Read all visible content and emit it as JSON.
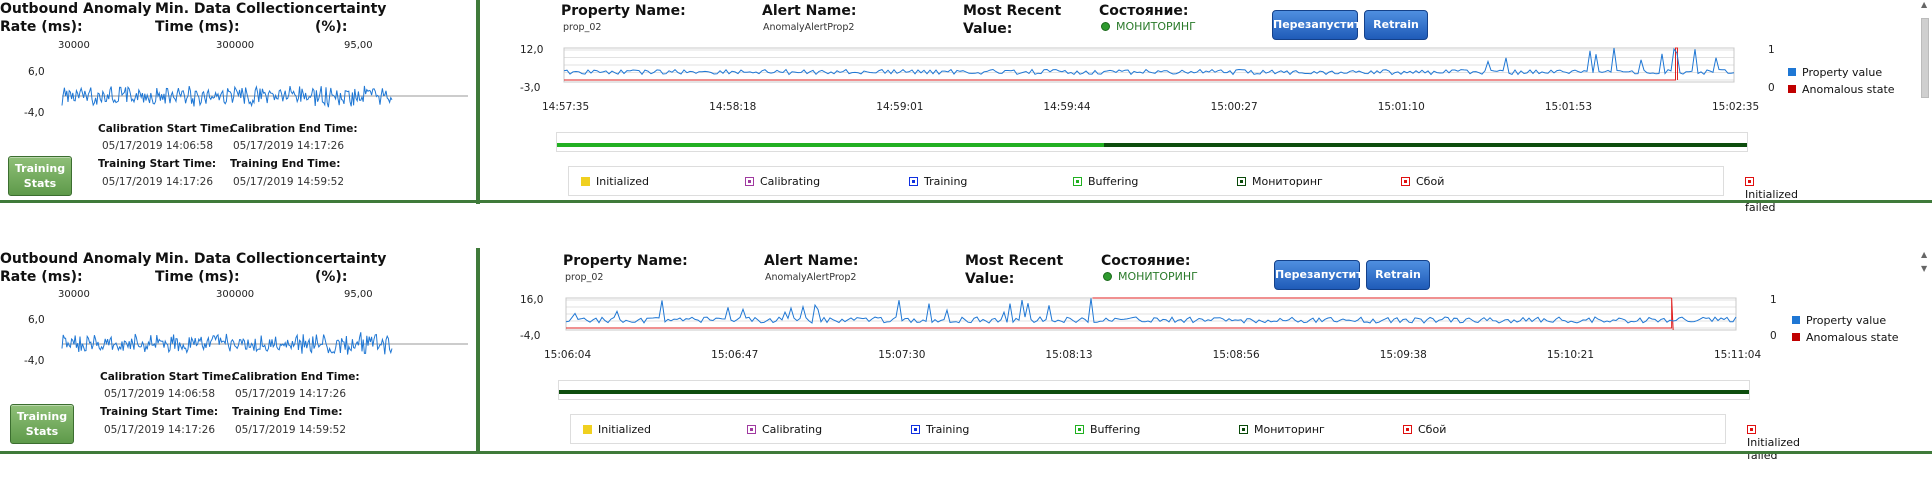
{
  "colors": {
    "series": "#1f77d4",
    "anomaly": "#e02020",
    "separator": "#3f7a3a",
    "buffering": "#22b022",
    "monitoring": "#0d4d0d"
  },
  "legend": {
    "items": [
      {
        "label": "Property value",
        "color": "#1f77d4"
      },
      {
        "label": "Anomalous state",
        "color": "#c00000"
      }
    ]
  },
  "states": [
    {
      "label": "Initialized",
      "color": "#f0d020"
    },
    {
      "label": "Calibrating",
      "color": "#a03aa0"
    },
    {
      "label": "Training",
      "color": "#1030e0"
    },
    {
      "label": "Buffering",
      "color": "#20b020"
    },
    {
      "label": "Мониторинг",
      "color": "#0a4a0a"
    },
    {
      "label": "Сбой",
      "color": "#e01010"
    },
    {
      "label": "Initialized failed",
      "color": "#e01010"
    }
  ],
  "panels": [
    {
      "outbound_label_1": "Outbound Anomaly",
      "outbound_label_2": "Rate (ms):",
      "outbound_value": "30000",
      "mincol_label_1": "Min. Data Collection",
      "mincol_label_2": "Time (ms):",
      "mincol_value": "300000",
      "certainty_label_1": "certainty",
      "certainty_label_2": "(%):",
      "certainty_value": "95,00",
      "mini_ymax": "6,0",
      "mini_ymin": "-4,0",
      "calib_start_label": "Calibration Start Time:",
      "calib_start_value": "05/17/2019 14:06:58",
      "calib_end_label": "Calibration End Time:",
      "calib_end_value": "05/17/2019 14:17:26",
      "train_start_label": "Training Start Time:",
      "train_start_value": "05/17/2019 14:17:26",
      "train_end_label": "Training End Time:",
      "train_end_value": "05/17/2019 14:59:52",
      "training_button_1": "Training",
      "training_button_2": "Stats",
      "property_label": "Property Name:",
      "property_value": "prop_02",
      "alert_label": "Alert Name:",
      "alert_value": "AnomalyAlertProp2",
      "recent_label_1": "Most Recent",
      "recent_label_2": "Value:",
      "state_label": "Состояние:",
      "state_value": "МОНИТОРИНГ",
      "restart_button": "Перезапустить",
      "retrain_button": "Retrain",
      "y_max": "12,0",
      "y_min": "-3,0",
      "y2_max": "1",
      "y2_min": "0",
      "x_ticks": [
        "14:57:35",
        "14:58:18",
        "14:59:01",
        "14:59:44",
        "15:00:27",
        "15:01:10",
        "15:01:53",
        "15:02:35"
      ],
      "buffering_fraction": 0.46,
      "anomaly_baseline_fraction": 0.95,
      "anomaly_spike_fraction": 0.95
    },
    {
      "outbound_label_1": "Outbound Anomaly",
      "outbound_label_2": "Rate (ms):",
      "outbound_value": "30000",
      "mincol_label_1": "Min. Data Collection",
      "mincol_label_2": "Time (ms):",
      "mincol_value": "300000",
      "certainty_label_1": "certainty",
      "certainty_label_2": "(%):",
      "certainty_value": "95,00",
      "mini_ymax": "6,0",
      "mini_ymin": "-4,0",
      "calib_start_label": "Calibration Start Time:",
      "calib_start_value": "05/17/2019 14:06:58",
      "calib_end_label": "Calibration End Time:",
      "calib_end_value": "05/17/2019 14:17:26",
      "train_start_label": "Training Start Time:",
      "train_start_value": "05/17/2019 14:17:26",
      "train_end_label": "Training End Time:",
      "train_end_value": "05/17/2019 14:59:52",
      "training_button_1": "Training",
      "training_button_2": "Stats",
      "property_label": "Property Name:",
      "property_value": "prop_02",
      "alert_label": "Alert Name:",
      "alert_value": "AnomalyAlertProp2",
      "recent_label_1": "Most Recent",
      "recent_label_2": "Value:",
      "state_label": "Состояние:",
      "state_value": "МОНИТОРИНГ",
      "restart_button": "Перезапустить",
      "retrain_button": "Retrain",
      "y_max": "16,0",
      "y_min": "-4,0",
      "y2_max": "1",
      "y2_min": "0",
      "x_ticks": [
        "15:06:04",
        "15:06:47",
        "15:07:30",
        "15:08:13",
        "15:08:56",
        "15:09:38",
        "15:10:21",
        "15:11:04"
      ],
      "buffering_fraction": 0.0,
      "anomaly_baseline_fraction": 0.0,
      "anomaly_spike_fraction": 0.945
    }
  ]
}
